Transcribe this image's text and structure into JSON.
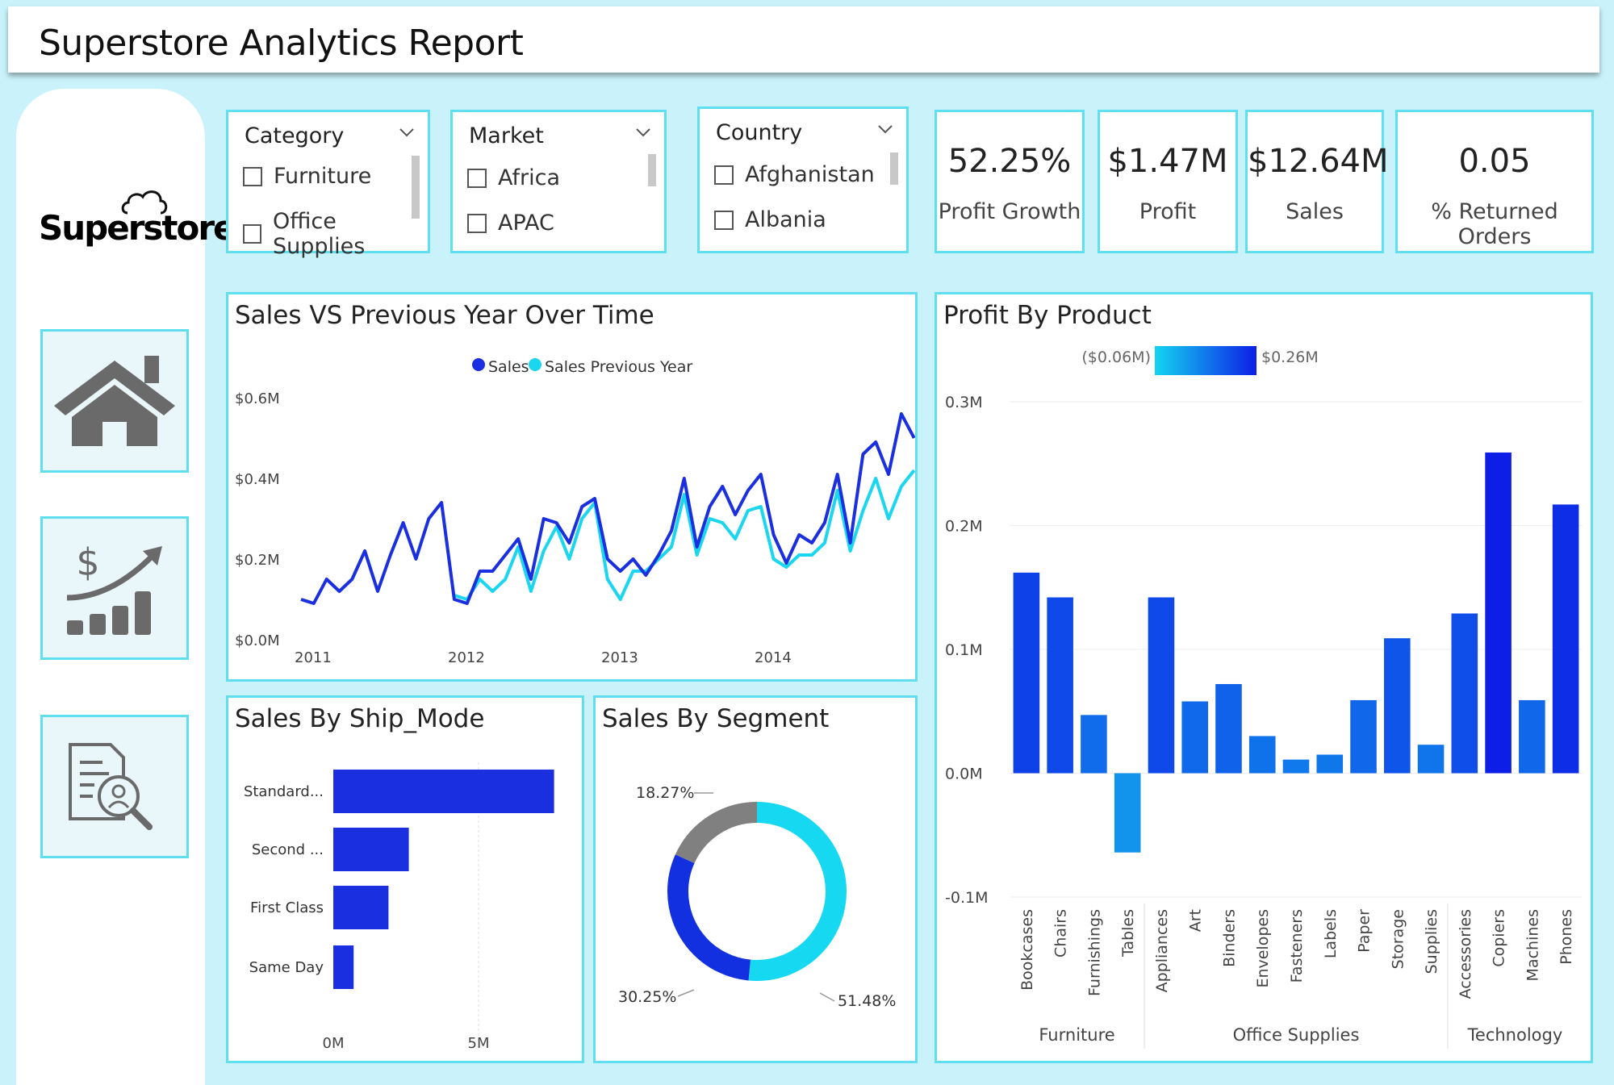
{
  "header": {
    "title": "Superstore Analytics Report"
  },
  "sidebar": {
    "logo_text": "Superstore",
    "nav": [
      {
        "icon": "home-icon"
      },
      {
        "icon": "sales-growth-icon"
      },
      {
        "icon": "document-search-icon"
      }
    ]
  },
  "slicers": {
    "category": {
      "title": "Category",
      "items": [
        "Furniture",
        "Office Supplies"
      ]
    },
    "market": {
      "title": "Market",
      "items": [
        "Africa",
        "APAC"
      ]
    },
    "country": {
      "title": "Country",
      "items": [
        "Afghanistan",
        "Albania"
      ]
    }
  },
  "kpis": {
    "profit_growth": {
      "value": "52.25%",
      "label": "Profit Growth"
    },
    "profit": {
      "value": "$1.47M",
      "label": "Profit"
    },
    "sales": {
      "value": "$12.64M",
      "label": "Sales"
    },
    "returned": {
      "value": "0.05",
      "label": "% Returned Orders"
    }
  },
  "colors": {
    "background": "#c9f2fa",
    "panel_border": "#5fdff0",
    "sales": "#1a2fe0",
    "sales_previous": "#1ad6ef",
    "grey": "#808080",
    "bar_dark": "#1040e8",
    "bar_light": "#19a8f0"
  },
  "line_chart": {
    "title": "Sales VS Previous Year Over Time",
    "chart_data": {
      "type": "line",
      "legend": [
        "Sales",
        "Sales Previous Year"
      ],
      "x_ticks": [
        "2011",
        "2012",
        "2013",
        "2014"
      ],
      "y_ticks": [
        "$0.0M",
        "$0.2M",
        "$0.4M",
        "$0.6M"
      ],
      "ylim": [
        0,
        0.6
      ],
      "x_start": 2011.0,
      "x_step": 0.0833,
      "series": [
        {
          "name": "Sales",
          "values": [
            0.1,
            0.09,
            0.15,
            0.12,
            0.15,
            0.22,
            0.12,
            0.21,
            0.29,
            0.2,
            0.3,
            0.34,
            0.1,
            0.09,
            0.17,
            0.17,
            0.21,
            0.25,
            0.15,
            0.3,
            0.29,
            0.24,
            0.33,
            0.35,
            0.2,
            0.17,
            0.2,
            0.16,
            0.21,
            0.27,
            0.4,
            0.23,
            0.33,
            0.38,
            0.31,
            0.37,
            0.41,
            0.26,
            0.19,
            0.26,
            0.24,
            0.29,
            0.41,
            0.24,
            0.46,
            0.49,
            0.41,
            0.56,
            0.5
          ]
        },
        {
          "name": "Sales Previous Year",
          "values": [
            null,
            null,
            null,
            null,
            null,
            null,
            null,
            null,
            null,
            null,
            null,
            null,
            0.11,
            0.1,
            0.15,
            0.12,
            0.15,
            0.23,
            0.12,
            0.22,
            0.28,
            0.2,
            0.3,
            0.34,
            0.15,
            0.1,
            0.17,
            0.17,
            0.2,
            0.23,
            0.36,
            0.21,
            0.3,
            0.29,
            0.25,
            0.32,
            0.33,
            0.2,
            0.18,
            0.21,
            0.21,
            0.24,
            0.37,
            0.22,
            0.32,
            0.4,
            0.3,
            0.38,
            0.42
          ]
        }
      ]
    }
  },
  "ship_chart": {
    "title": "Sales By Ship_Mode",
    "chart_data": {
      "type": "bar",
      "orientation": "horizontal",
      "categories": [
        "Standard...",
        "Second ...",
        "First Class",
        "Same Day"
      ],
      "values": [
        7.6,
        2.6,
        1.9,
        0.7
      ],
      "x_ticks": [
        "0M",
        "5M"
      ],
      "xlim": [
        0,
        8
      ]
    }
  },
  "segment_chart": {
    "title": "Sales By Segment",
    "chart_data": {
      "type": "pie",
      "donut": true,
      "labels": [
        "18.27%",
        "30.25%",
        "51.48%"
      ],
      "values": [
        18.27,
        30.25,
        51.48
      ],
      "colors": [
        "#808080",
        "#1230e0",
        "#16d8f1"
      ]
    }
  },
  "profit_chart": {
    "title": "Profit By Product",
    "legend": {
      "min": "($0.06M)",
      "max": "$0.26M"
    },
    "chart_data": {
      "type": "bar",
      "categories": [
        "Bookcases",
        "Chairs",
        "Furnishings",
        "Tables",
        "Appliances",
        "Art",
        "Binders",
        "Envelopes",
        "Fasteners",
        "Labels",
        "Paper",
        "Storage",
        "Supplies",
        "Accessories",
        "Copiers",
        "Machines",
        "Phones"
      ],
      "groups": [
        {
          "name": "Furniture",
          "count": 4
        },
        {
          "name": "Office Supplies",
          "count": 9
        },
        {
          "name": "Technology",
          "count": 4
        }
      ],
      "values": [
        0.162,
        0.142,
        0.047,
        -0.064,
        0.142,
        0.058,
        0.072,
        0.03,
        0.011,
        0.015,
        0.059,
        0.109,
        0.023,
        0.129,
        0.259,
        0.059,
        0.217
      ],
      "y_ticks": [
        "0.3M",
        "0.2M",
        "0.1M",
        "0.0M",
        "-0.1M"
      ],
      "ylim": [
        -0.1,
        0.3
      ]
    }
  }
}
